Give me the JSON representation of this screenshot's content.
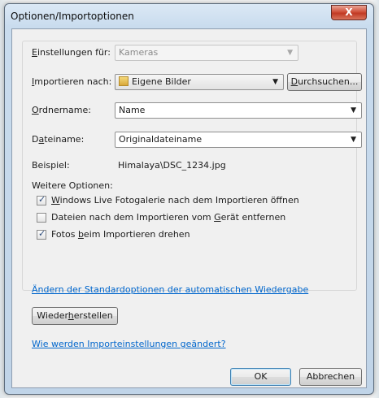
{
  "window": {
    "title": "Optionen/Importoptionen",
    "close_glyph": "X"
  },
  "settings_for": {
    "label_u": "E",
    "label_rest": "instellungen für:",
    "value": "Kameras",
    "enabled": false
  },
  "import_to": {
    "label_u": "I",
    "label_rest": "mportieren nach:",
    "value": "Eigene Bilder",
    "browse_u": "D",
    "browse_rest": "urchsuchen..."
  },
  "folder_name": {
    "label_u": "O",
    "label_rest": "rdnername:",
    "value": "Name"
  },
  "file_name": {
    "label_pre": "D",
    "label_u": "a",
    "label_rest": "teiname:",
    "value": "Originaldateiname"
  },
  "example": {
    "label": "Beispiel:",
    "value": "Himalaya\\DSC_1234.jpg"
  },
  "more_options": {
    "heading": "Weitere Optionen:",
    "items": [
      {
        "pre": "",
        "u": "W",
        "post": "indows Live Fotogalerie nach dem Importieren öffnen",
        "checked": true
      },
      {
        "pre": "Dateien nach dem Importieren vom ",
        "u": "G",
        "post": "erät entfernen",
        "checked": false
      },
      {
        "pre": "Fotos ",
        "u": "b",
        "post": "eim Importieren drehen",
        "checked": true
      }
    ]
  },
  "autoplay_link": "Ändern der Standardoptionen der automatischen Wiedergabe",
  "restore_button": {
    "pre": "Wieder",
    "u": "h",
    "post": "erstellen"
  },
  "help_link": "Wie werden Importeinstellungen geändert?",
  "ok_button": "OK",
  "cancel_button": "Abbrechen"
}
